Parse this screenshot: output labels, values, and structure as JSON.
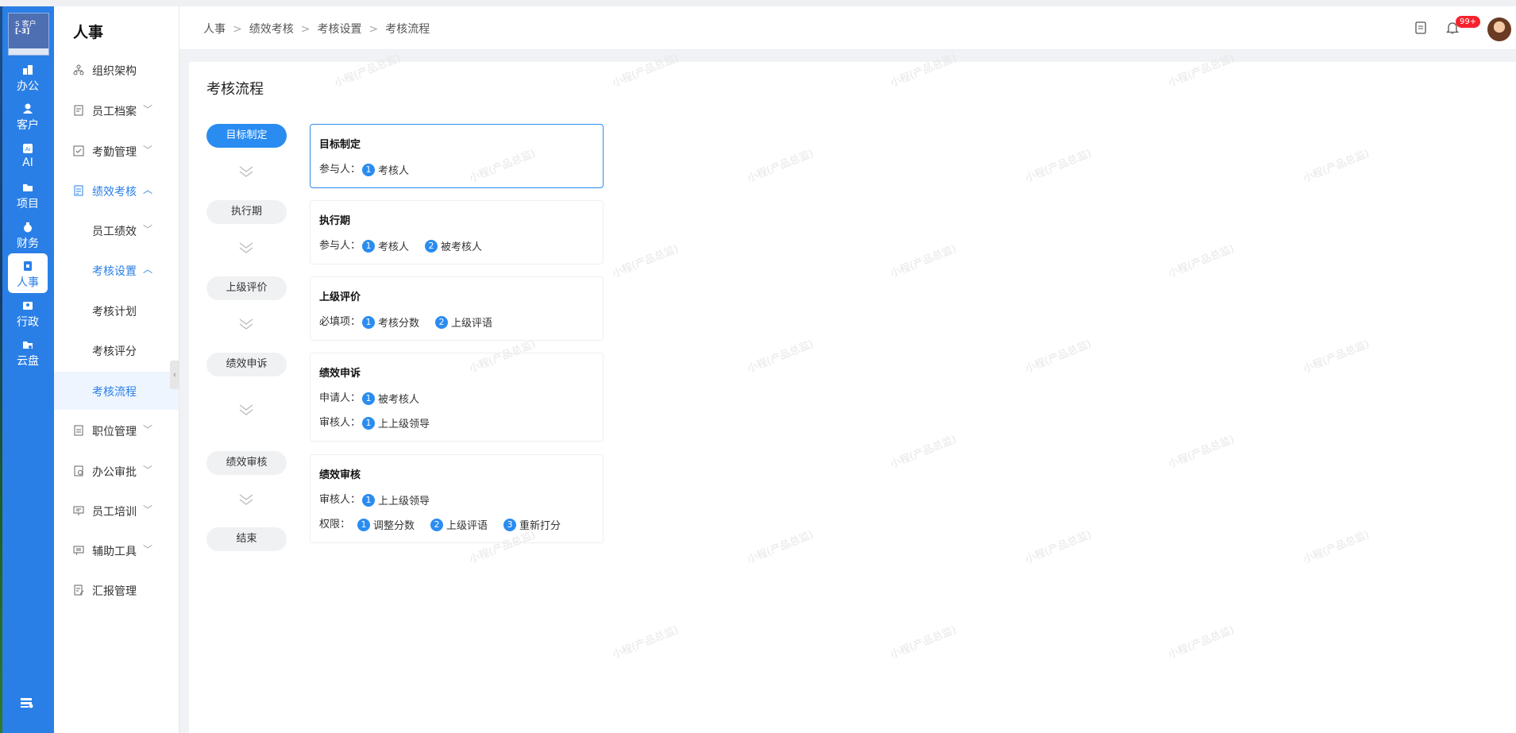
{
  "app_nav": {
    "logo_line1": "S 客户",
    "logo_line2": "[-3]",
    "items": [
      {
        "label": "办公",
        "icon": "office-icon"
      },
      {
        "label": "客户",
        "icon": "customer-icon"
      },
      {
        "label": "AI",
        "icon": "ai-icon"
      },
      {
        "label": "项目",
        "icon": "folder-icon"
      },
      {
        "label": "财务",
        "icon": "money-bag-icon"
      },
      {
        "label": "人事",
        "icon": "badge-icon"
      },
      {
        "label": "行政",
        "icon": "admin-icon"
      },
      {
        "label": "云盘",
        "icon": "cloud-folder-icon"
      }
    ]
  },
  "sidebar": {
    "title": "人事",
    "items": [
      {
        "label": "组织架构"
      },
      {
        "label": "员工档案",
        "arrow": "﹀"
      },
      {
        "label": "考勤管理",
        "arrow": "﹀"
      },
      {
        "label": "绩效考核",
        "arrow": "︿"
      },
      {
        "label": "员工绩效",
        "arrow": "﹀"
      },
      {
        "label": "考核设置",
        "arrow": "︿"
      },
      {
        "label": "考核计划"
      },
      {
        "label": "考核评分"
      },
      {
        "label": "考核流程"
      },
      {
        "label": "职位管理",
        "arrow": "﹀"
      },
      {
        "label": "办公审批",
        "arrow": "﹀"
      },
      {
        "label": "员工培训",
        "arrow": "﹀"
      },
      {
        "label": "辅助工具",
        "arrow": "﹀"
      },
      {
        "label": "汇报管理"
      }
    ]
  },
  "header": {
    "breadcrumb": [
      "人事",
      "绩效考核",
      "考核设置",
      "考核流程"
    ],
    "notifications_badge": "99+"
  },
  "page": {
    "title": "考核流程",
    "steps": [
      "目标制定",
      "执行期",
      "上级评价",
      "绩效申诉",
      "绩效审核",
      "结束"
    ],
    "cards": [
      {
        "title": "目标制定",
        "rows": [
          {
            "label": "参与人：",
            "items": [
              "考核人"
            ]
          }
        ]
      },
      {
        "title": "执行期",
        "rows": [
          {
            "label": "参与人：",
            "items": [
              "考核人",
              "被考核人"
            ]
          }
        ]
      },
      {
        "title": "上级评价",
        "rows": [
          {
            "label": "必填项：",
            "items": [
              "考核分数",
              "上级评语"
            ]
          }
        ]
      },
      {
        "title": "绩效申诉",
        "rows": [
          {
            "label": "申请人：",
            "items": [
              "被考核人"
            ]
          },
          {
            "label": "审核人：",
            "items": [
              "上上级领导"
            ]
          }
        ]
      },
      {
        "title": "绩效审核",
        "rows": [
          {
            "label": "审核人：",
            "items": [
              "上上级领导"
            ]
          },
          {
            "label": "权限：",
            "items": [
              "调整分数",
              "上级评语",
              "重新打分"
            ]
          }
        ]
      }
    ]
  },
  "watermark_text": "小程(产品总监)",
  "colors": {
    "primary": "#2a8cf0",
    "nav_bg": "#2a7fe6",
    "badge": "#f5222d"
  }
}
